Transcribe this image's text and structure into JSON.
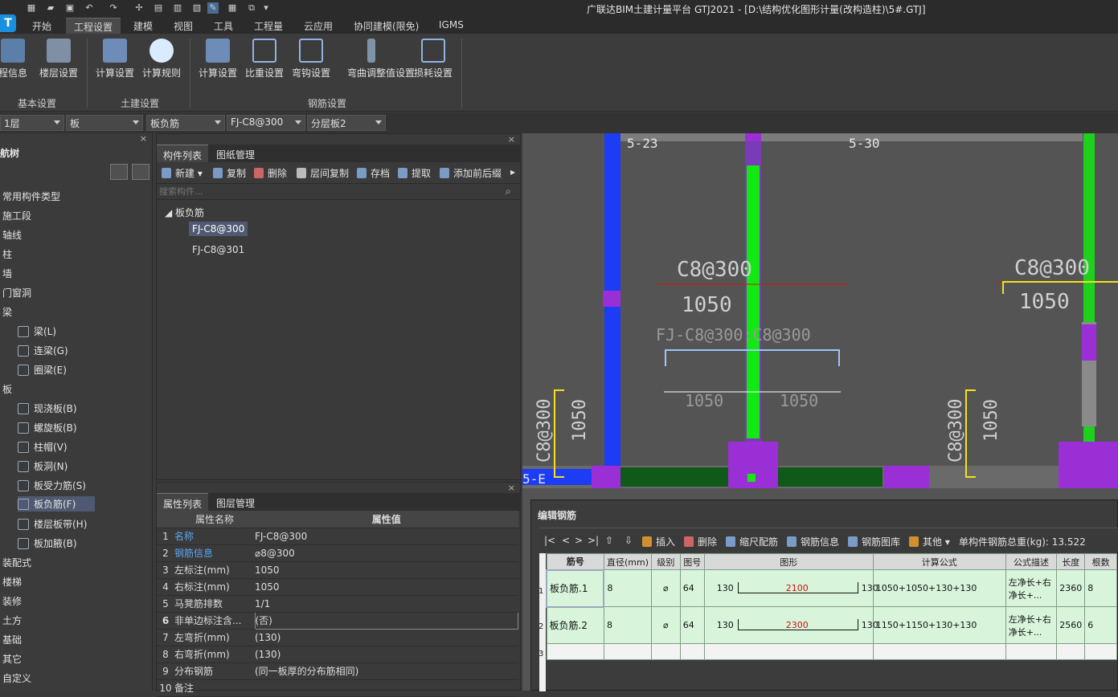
{
  "window": {
    "title": "广联达BIM土建计量平台 GTJ2021 - [D:\\结构优化图形计量(改构造柱)\\5#.GTJ]"
  },
  "menu": {
    "items": [
      "开始",
      "工程设置",
      "建模",
      "视图",
      "工具",
      "工程量",
      "云应用",
      "协同建模(限免)",
      "IGMS"
    ]
  },
  "ribbon": {
    "buttons": [
      "程信息",
      "楼层设置",
      "计算设置",
      "计算规则",
      "计算设置",
      "比重设置",
      "弯钩设置",
      "弯曲调整值设置",
      "损耗设置"
    ],
    "groups": [
      "基本设置",
      "土建设置",
      "钢筋设置"
    ]
  },
  "filters": [
    "1层",
    "板",
    "板负筋",
    "FJ-C8@300",
    "分层板2"
  ],
  "nav": {
    "title": "航树",
    "items": [
      "常用构件类型",
      "施工段",
      "轴线",
      "柱",
      "墙",
      "门窗洞",
      "梁"
    ],
    "beam_children": [
      "梁(L)",
      "连梁(G)",
      "圈梁(E)"
    ],
    "slab": "板",
    "slab_children": [
      "现浇板(B)",
      "螺旋板(B)",
      "柱帽(V)",
      "板洞(N)",
      "板受力筋(S)",
      "板负筋(F)",
      "楼层板带(H)",
      "板加腋(B)"
    ],
    "rest": [
      "装配式",
      "楼梯",
      "装修",
      "土方",
      "基础",
      "其它",
      "自定义"
    ]
  },
  "components": {
    "tabs": [
      "构件列表",
      "图纸管理"
    ],
    "toolbar": [
      "新建",
      "复制",
      "删除",
      "层间复制",
      "存档",
      "提取",
      "添加前后缀"
    ],
    "search_placeholder": "搜索构件...",
    "root": "板负筋",
    "items": [
      "FJ-C8@300",
      "FJ-C8@301"
    ]
  },
  "properties": {
    "tabs": [
      "属性列表",
      "图层管理"
    ],
    "header": [
      "属性名称",
      "属性值"
    ],
    "rows": [
      {
        "n": "1",
        "name": "名称",
        "value": "FJ-C8@300"
      },
      {
        "n": "2",
        "name": "钢筋信息",
        "value": "⌀8@300"
      },
      {
        "n": "3",
        "name": "左标注(mm)",
        "value": "1050"
      },
      {
        "n": "4",
        "name": "右标注(mm)",
        "value": "1050"
      },
      {
        "n": "5",
        "name": "马凳筋排数",
        "value": "1/1"
      },
      {
        "n": "6",
        "name": "非单边标注含...",
        "value": "(否)"
      },
      {
        "n": "7",
        "name": "左弯折(mm)",
        "value": "(130)"
      },
      {
        "n": "8",
        "name": "右弯折(mm)",
        "value": "(130)"
      },
      {
        "n": "9",
        "name": "分布钢筋",
        "value": "(同一板厚的分布筋相同)"
      },
      {
        "n": "10",
        "name": "备注",
        "value": ""
      }
    ]
  },
  "canvas": {
    "axis_labels": [
      "5-23",
      "5-30",
      "5-E"
    ],
    "labels": [
      "C8@300",
      "1050",
      "C8@300",
      "1050",
      "FJ-C8@300:C8@300",
      "1050",
      "1050",
      "C8@300",
      "1050",
      "C8@300",
      "1050"
    ]
  },
  "rebar_editor": {
    "title": "编辑钢筋",
    "toolbar": [
      "插入",
      "删除",
      "缩尺配筋",
      "钢筋信息",
      "钢筋图库",
      "其他"
    ],
    "total": "单构件钢筋总重(kg): 13.522",
    "headers": [
      "筋号",
      "直径(mm)",
      "级别",
      "图号",
      "图形",
      "计算公式",
      "公式描述",
      "长度",
      "根数"
    ],
    "rows": [
      {
        "n": "1",
        "name": "板负筋.1",
        "dia": "8",
        "grade": "⌀",
        "fig": "64",
        "left": "130",
        "mid": "2100",
        "right": "130",
        "formula": "1050+1050+130+130",
        "desc": "左净长+右净长+...",
        "len": "2360",
        "count": "8"
      },
      {
        "n": "2",
        "name": "板负筋.2",
        "dia": "8",
        "grade": "⌀",
        "fig": "64",
        "left": "130",
        "mid": "2300",
        "right": "130",
        "formula": "1150+1150+130+130",
        "desc": "左净长+右净长+...",
        "len": "2560",
        "count": "6"
      },
      {
        "n": "3",
        "name": "",
        "dia": "",
        "grade": "",
        "fig": "",
        "left": "",
        "mid": "",
        "right": "",
        "formula": "",
        "desc": "",
        "len": "",
        "count": ""
      }
    ]
  },
  "colors": {
    "accent": "#0a84d6",
    "canvas_bg": "#545454",
    "grid_row": "#d8f5dc"
  }
}
